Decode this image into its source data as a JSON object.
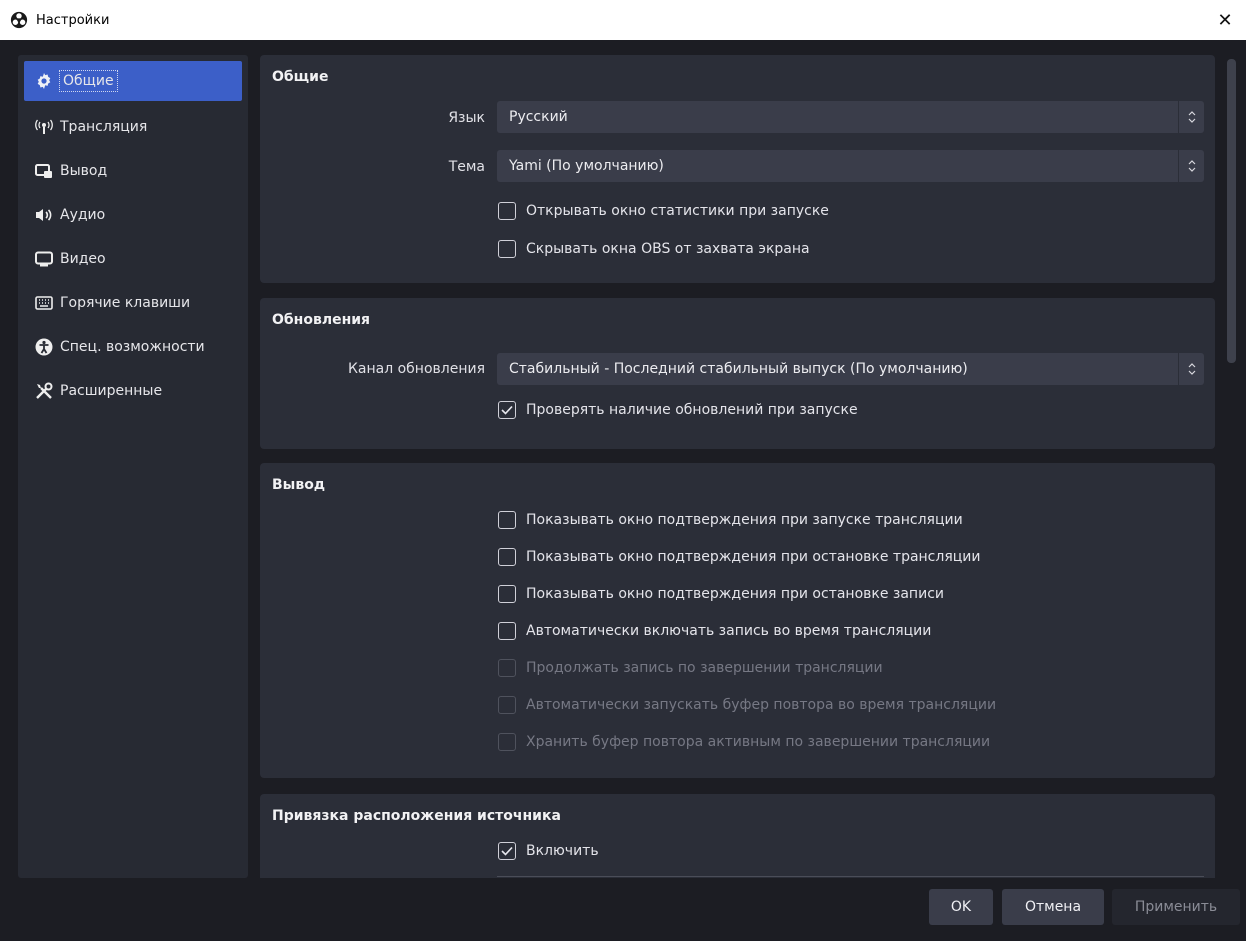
{
  "window": {
    "title": "Настройки",
    "close_glyph": "✕"
  },
  "sidebar": {
    "items": [
      {
        "label": "Общие",
        "icon": "gear-icon",
        "active": true
      },
      {
        "label": "Трансляция",
        "icon": "antenna-icon"
      },
      {
        "label": "Вывод",
        "icon": "output-icon"
      },
      {
        "label": "Аудио",
        "icon": "speaker-icon"
      },
      {
        "label": "Видео",
        "icon": "monitor-icon"
      },
      {
        "label": "Горячие клавиши",
        "icon": "keyboard-icon"
      },
      {
        "label": "Спец. возможности",
        "icon": "accessibility-icon"
      },
      {
        "label": "Расширенные",
        "icon": "tools-icon"
      }
    ]
  },
  "general": {
    "title": "Общие",
    "language_label": "Язык",
    "language_value": "Русский",
    "theme_label": "Тема",
    "theme_value": "Yami (По умолчанию)",
    "checks": [
      {
        "label": "Открывать окно статистики при запуске",
        "checked": false
      },
      {
        "label": "Скрывать окна OBS от захвата экрана",
        "checked": false
      }
    ]
  },
  "updates": {
    "title": "Обновления",
    "channel_label": "Канал обновления",
    "channel_value": "Стабильный - Последний стабильный выпуск (По умолчанию)",
    "check_label": "Проверять наличие обновлений при запуске",
    "check_checked": true
  },
  "output": {
    "title": "Вывод",
    "checks": [
      {
        "label": "Показывать окно подтверждения при запуске трансляции",
        "checked": false,
        "enabled": true
      },
      {
        "label": "Показывать окно подтверждения при остановке трансляции",
        "checked": false,
        "enabled": true
      },
      {
        "label": "Показывать окно подтверждения при остановке записи",
        "checked": false,
        "enabled": true
      },
      {
        "label": "Автоматически включать запись во время трансляции",
        "checked": false,
        "enabled": true
      },
      {
        "label": "Продолжать запись по завершении трансляции",
        "checked": false,
        "enabled": false
      },
      {
        "label": "Автоматически запускать буфер повтора во время трансляции",
        "checked": false,
        "enabled": false
      },
      {
        "label": "Хранить буфер повтора активным по завершении трансляции",
        "checked": false,
        "enabled": false
      }
    ]
  },
  "snapping": {
    "title": "Привязка расположения источника",
    "enable_label": "Включить",
    "enable_checked": true
  },
  "footer": {
    "ok": "OK",
    "cancel": "Отмена",
    "apply": "Применить"
  },
  "colors": {
    "background": "#1c1d23",
    "panel": "#2b2e38",
    "sidebar": "#272a33",
    "accent": "#3c5fc8",
    "input": "#3a3d4a"
  }
}
